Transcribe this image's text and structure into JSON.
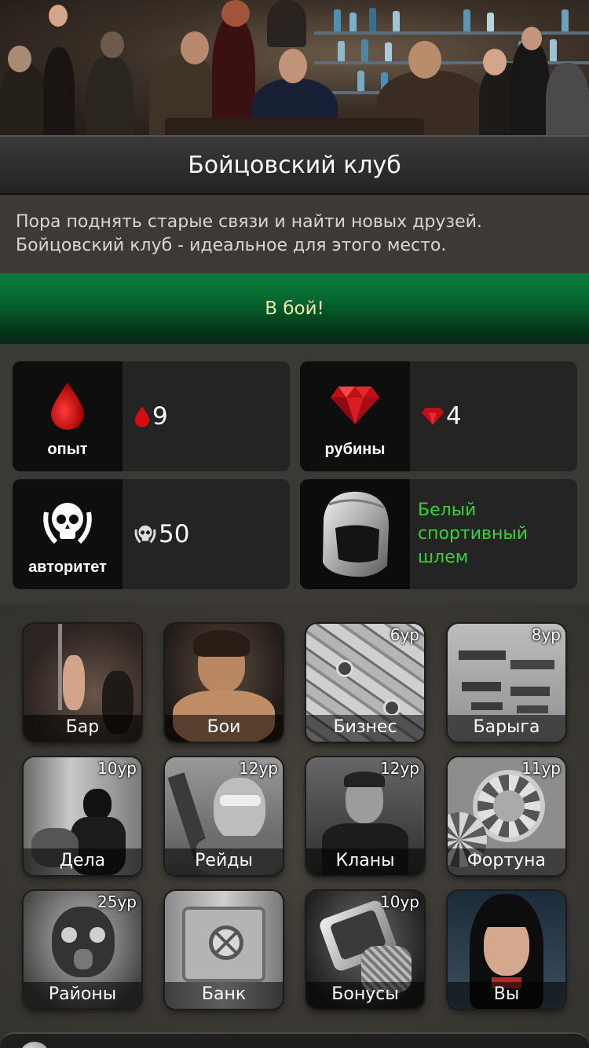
{
  "header": {
    "title": "Бойцовский клуб"
  },
  "description": {
    "line1": "Пора поднять старые связи и найти новых друзей.",
    "line2": "Бойцовский клуб - идеальное для этого место."
  },
  "fight_button": {
    "label": "В бой!"
  },
  "rewards": {
    "experience": {
      "caption": "опыт",
      "icon": "blood-drop-icon",
      "value": "9"
    },
    "rubies": {
      "caption": "рубины",
      "icon": "ruby-icon",
      "value": "4"
    },
    "authority": {
      "caption": "авторитет",
      "icon": "skull-laurel-icon",
      "value": "50"
    },
    "item": {
      "icon": "boxing-helmet-icon",
      "line1": "Белый",
      "line2": "спортивный",
      "line3": "шлем",
      "color": "#3ad13a"
    }
  },
  "menu": [
    {
      "label": "Бар",
      "level": ""
    },
    {
      "label": "Бои",
      "level": ""
    },
    {
      "label": "Бизнес",
      "level": "6ур"
    },
    {
      "label": "Барыга",
      "level": "8ур"
    },
    {
      "label": "Дела",
      "level": "10ур"
    },
    {
      "label": "Рейды",
      "level": "12ур"
    },
    {
      "label": "Кланы",
      "level": "12ур"
    },
    {
      "label": "Фортуна",
      "level": "11ур"
    },
    {
      "label": "Районы",
      "level": "25ур"
    },
    {
      "label": "Банк",
      "level": ""
    },
    {
      "label": "Бонусы",
      "level": "10ур"
    },
    {
      "label": "Вы",
      "level": ""
    }
  ],
  "colors": {
    "accent_green": "#066a30",
    "button_text": "#f3e6a8",
    "item_green": "#3ad13a"
  }
}
